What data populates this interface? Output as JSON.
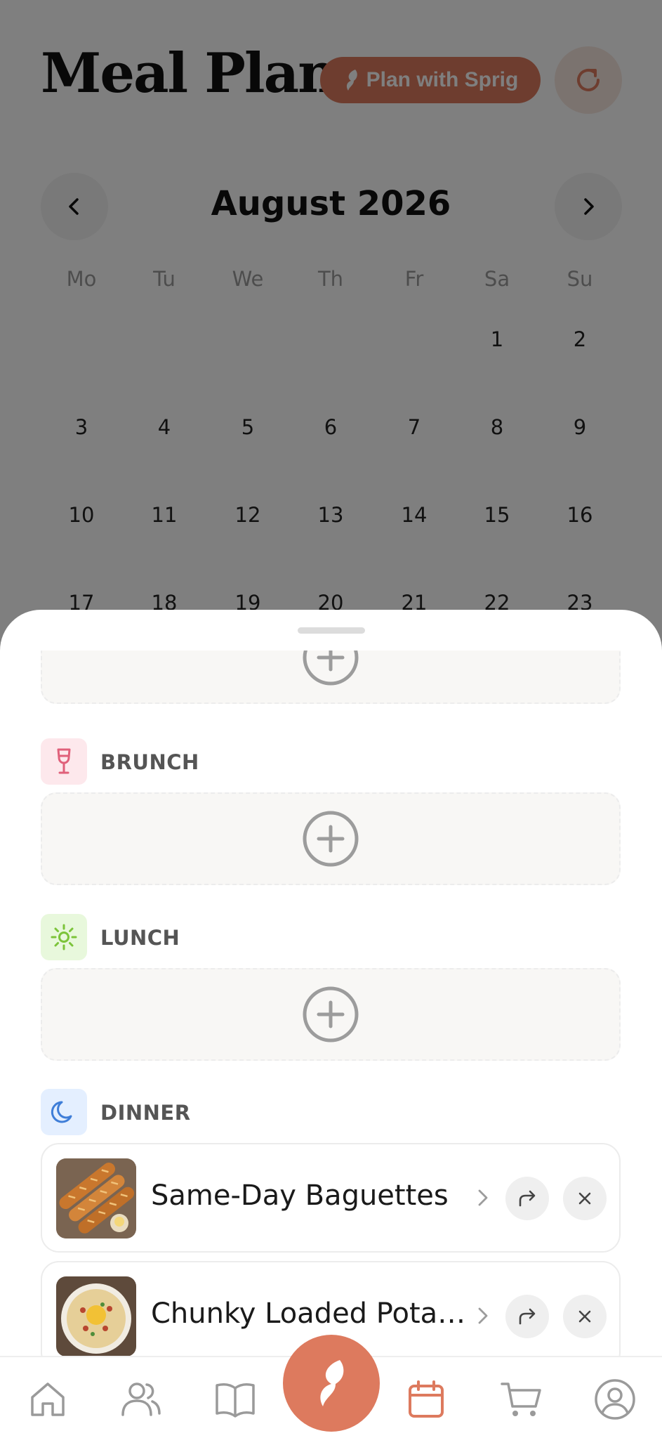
{
  "header": {
    "title": "Meal Plan",
    "plan_button_label": "Plan with Sprig",
    "refresh_icon": "refresh-icon"
  },
  "calendar": {
    "month_label": "August 2026",
    "prev_icon": "chevron-left-icon",
    "next_icon": "chevron-right-icon",
    "weekdays": [
      "Mo",
      "Tu",
      "We",
      "Th",
      "Fr",
      "Sa",
      "Su"
    ],
    "weeks": [
      [
        "",
        "",
        "",
        "",
        "",
        "1",
        "2"
      ],
      [
        "3",
        "4",
        "5",
        "6",
        "7",
        "8",
        "9"
      ],
      [
        "10",
        "11",
        "12",
        "13",
        "14",
        "15",
        "16"
      ],
      [
        "17",
        "18",
        "19",
        "20",
        "21",
        "22",
        "23"
      ]
    ]
  },
  "sheet": {
    "sections": [
      {
        "label": "BRUNCH",
        "icon": "wine-glass-icon"
      },
      {
        "label": "LUNCH",
        "icon": "sun-icon"
      },
      {
        "label": "DINNER",
        "icon": "moon-icon"
      }
    ],
    "dinner_meals": [
      {
        "name": "Same-Day Baguettes",
        "image": "baguettes-photo"
      },
      {
        "name": "Chunky Loaded Pota…",
        "image": "potato-soup-photo"
      }
    ]
  },
  "bottom_nav": {
    "items": [
      "home-icon",
      "users-icon",
      "book-icon",
      "sprig-icon",
      "calendar-icon",
      "cart-icon",
      "profile-icon"
    ],
    "active": "calendar-icon"
  },
  "colors": {
    "accent": "#dd7a5e",
    "brunch_bg": "#fde8ec",
    "brunch_icon": "#e0607a",
    "lunch_bg": "#e8f8dc",
    "lunch_icon": "#7cc43a",
    "dinner_bg": "#e4efff",
    "dinner_icon": "#3f7ed8"
  }
}
